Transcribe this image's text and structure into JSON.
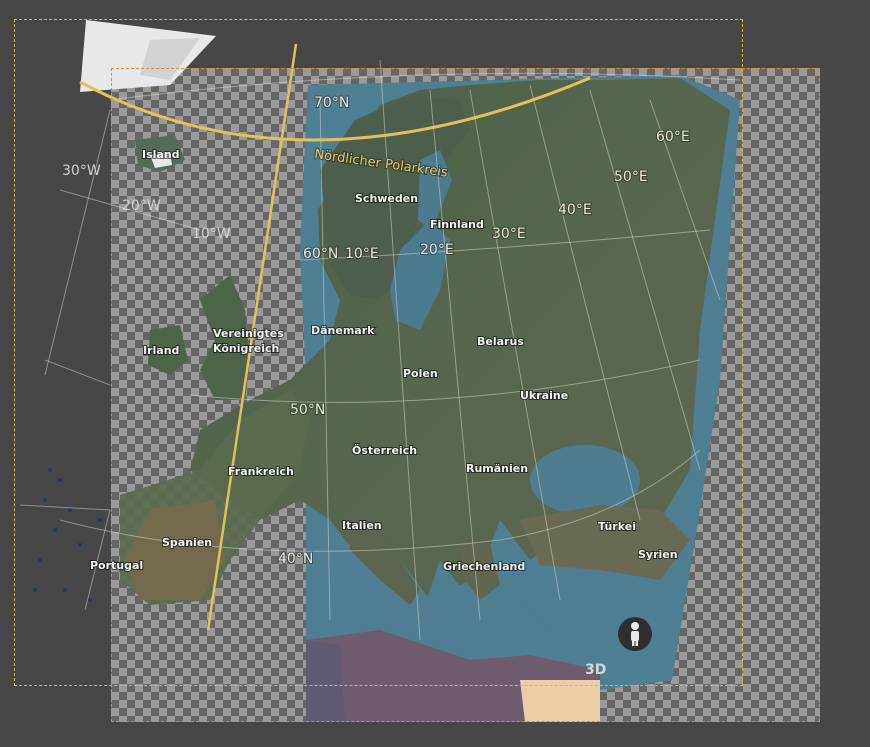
{
  "labels": {
    "arctic_circle": "Nördlicher Polarkreis",
    "countries": {
      "island": "Island",
      "schweden": "Schweden",
      "finnland": "Finnland",
      "daenemark": "Dänemark",
      "irland": "Irland",
      "vk_line1": "Vereinigtes",
      "vk_line2": "Königreich",
      "belarus": "Belarus",
      "polen": "Polen",
      "ukraine": "Ukraine",
      "oesterreich": "Österreich",
      "frankreich": "Frankreich",
      "rumaenien": "Rumänien",
      "italien": "Italien",
      "spanien": "Spanien",
      "portugal": "Portugal",
      "griechenland": "Griechenland",
      "tuerkei": "Türkei",
      "syrien": "Syrien"
    },
    "grid": {
      "lat70": "70°N",
      "lat60": "60°N",
      "lat50": "50°N",
      "lat40": "40°N",
      "lon30w": "30°W",
      "lon20w": "20°W",
      "lon10w": "10°W",
      "lon10e": "10°E",
      "lon20e": "20°E",
      "lon30e": "30°E",
      "lon40e": "40°E",
      "lon50e": "50°E",
      "lon60e": "60°E"
    }
  },
  "controls": {
    "view_3d": "3D",
    "pegman": "person-icon"
  },
  "colors": {
    "canvas_bg": "#474747",
    "selection_border": "#d9b54a",
    "arctic_circle": "#e2c05a",
    "land": "#51624c",
    "water": "#4f7f93"
  }
}
